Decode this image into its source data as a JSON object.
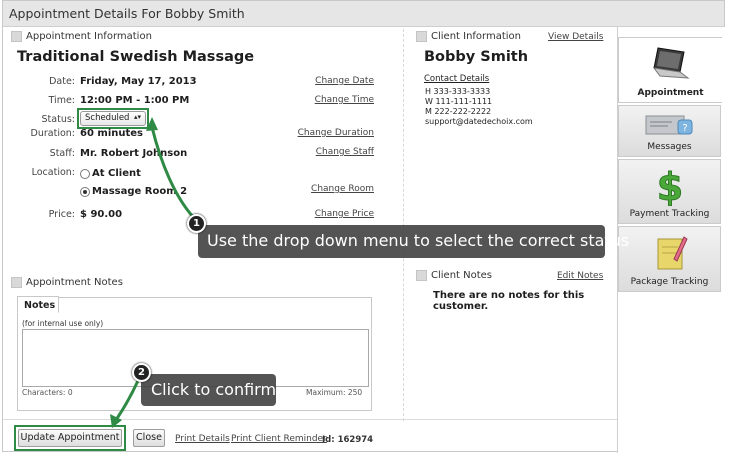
{
  "window": {
    "title": "Appointment Details For Bobby Smith"
  },
  "appointment": {
    "section_label": "Appointment Information",
    "service_name": "Traditional Swedish Massage",
    "fields": {
      "date_label": "Date:",
      "date_value": "Friday, May 17, 2013",
      "date_link": "Change Date",
      "time_label": "Time:",
      "time_value": "12:00 PM - 1:00 PM",
      "time_link": "Change Time",
      "status_label": "Status:",
      "status_value": "Scheduled",
      "duration_label": "Duration:",
      "duration_value": "60 minutes",
      "duration_link": "Change Duration",
      "staff_label": "Staff:",
      "staff_value": "Mr. Robert Johnson",
      "staff_link": "Change Staff",
      "location_label": "Location:",
      "location_option_1": "At Client",
      "location_option_2": "Massage Room 2",
      "location_selected": "Massage Room 2",
      "location_link": "Change Room",
      "price_label": "Price:",
      "price_value": "$ 90.00",
      "price_link": "Change Price"
    }
  },
  "client": {
    "section_label": "Client Information",
    "view_link": "View Details",
    "name": "Bobby Smith",
    "contact_heading": "Contact Details",
    "home_phone": "H  333-333-3333",
    "work_phone": "W  111-111-1111",
    "mobile_phone": "M  222-222-2222",
    "email": "support@datedechoix.com"
  },
  "appointment_notes": {
    "section_label": "Appointment Notes",
    "tab_label": "Notes",
    "hint": "(for internal use only)",
    "characters": "Characters: 0",
    "maximum": "Maximum:  250"
  },
  "client_notes": {
    "section_label": "Client Notes",
    "edit_link": "Edit Notes",
    "empty_text": "There are no notes for this customer."
  },
  "footer": {
    "update_button": "Update Appointment",
    "close_button": "Close",
    "print_details": "Print Details",
    "print_reminder": "Print Client Reminder",
    "id_text": "Id:  162974"
  },
  "sidenav": {
    "items": [
      {
        "label": "Appointment",
        "icon": "laptop-icon",
        "active": true
      },
      {
        "label": "Messages",
        "icon": "envelope-icon",
        "active": false
      },
      {
        "label": "Payment Tracking",
        "icon": "dollar-icon",
        "active": false
      },
      {
        "label": "Package Tracking",
        "icon": "notepad-pencil-icon",
        "active": false
      }
    ]
  },
  "callouts": [
    {
      "number": "1",
      "text": "Use the drop down menu to select the correct status"
    },
    {
      "number": "2",
      "text": "Click to confirm"
    }
  ],
  "colors": {
    "highlight": "#2f8a45",
    "callout_bg": "#3c3c3c",
    "title_bar": "#e6e6e6"
  }
}
